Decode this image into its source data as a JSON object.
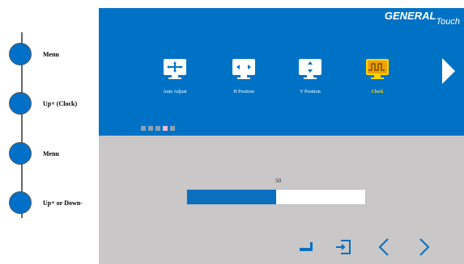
{
  "instructions": {
    "steps": [
      {
        "label": "Menu"
      },
      {
        "label": "Up+ (Clock)"
      },
      {
        "label": "Menu"
      },
      {
        "label": "Up+ or Down-"
      }
    ]
  },
  "osd": {
    "brand": {
      "name": "GENERAL",
      "suffix": "Touch"
    },
    "menu_items": [
      {
        "label": "Auto Adjust",
        "icon": "auto-adjust-icon",
        "selected": false
      },
      {
        "label": "H Position",
        "icon": "h-position-icon",
        "selected": false
      },
      {
        "label": "V Position",
        "icon": "v-position-icon",
        "selected": false
      },
      {
        "label": "Clock",
        "icon": "clock-icon",
        "selected": true
      }
    ],
    "page_dots": {
      "count": 5,
      "active_index": 3
    },
    "slider": {
      "value": "50",
      "fill_fraction": 0.5
    },
    "nav_buttons": [
      {
        "icon": "enter-icon"
      },
      {
        "icon": "exit-icon"
      },
      {
        "icon": "left-arrow-icon"
      },
      {
        "icon": "right-arrow-icon"
      }
    ],
    "colors": {
      "panel_blue": "#0072c6",
      "panel_gray": "#c9c7c7",
      "selected_text": "#ffd400",
      "step_dot": "#0070c8"
    }
  }
}
